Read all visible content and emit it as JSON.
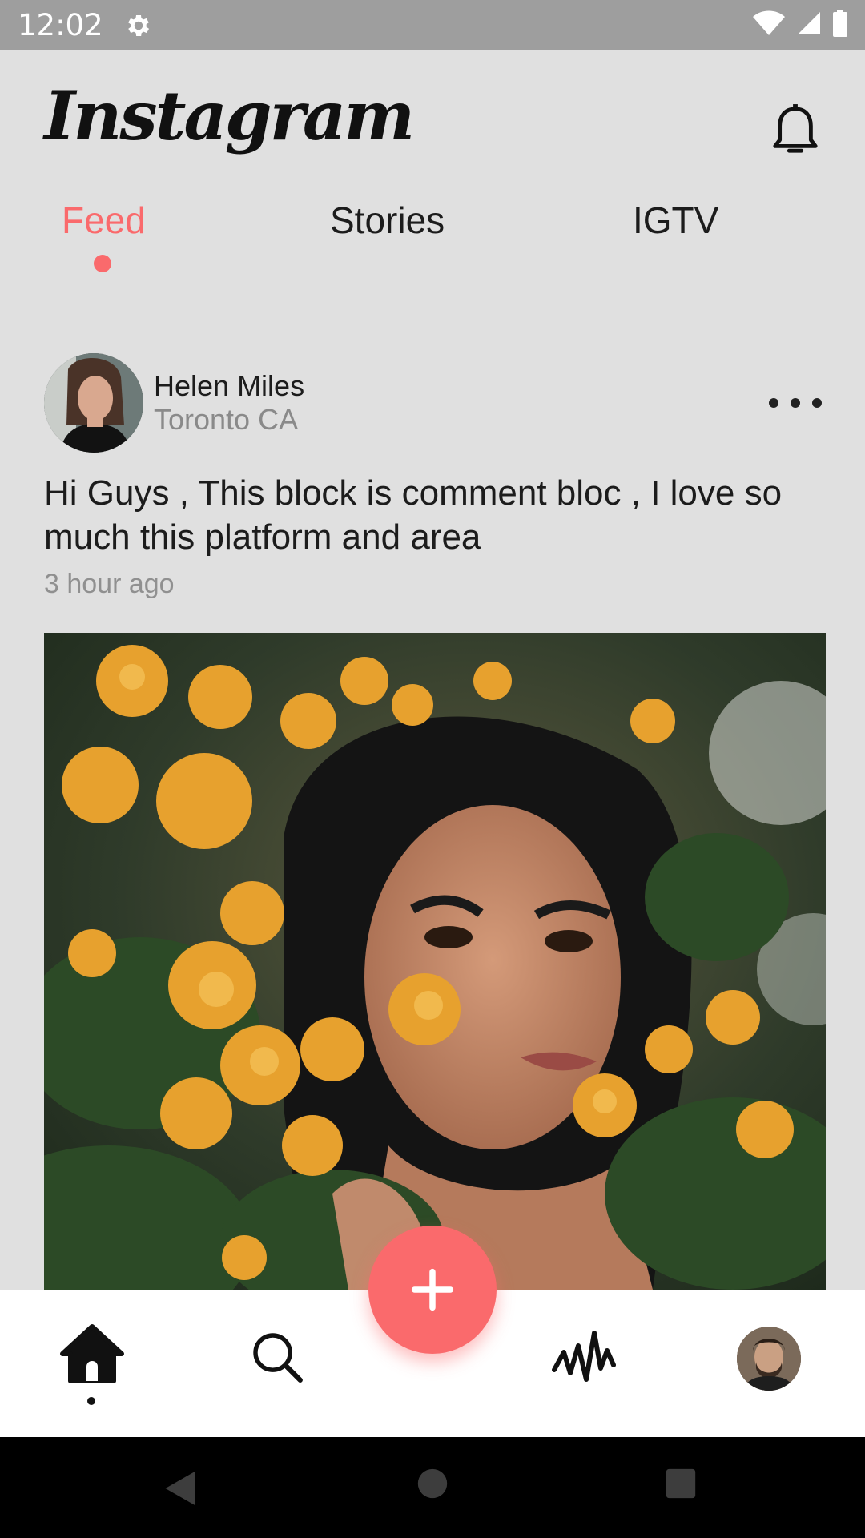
{
  "status_bar": {
    "time": "12:02",
    "icons": [
      "settings-icon",
      "wifi-icon",
      "signal-icon",
      "battery-icon"
    ]
  },
  "header": {
    "logo_text": "Instagram",
    "bell_icon": "bell-icon"
  },
  "tabs": [
    {
      "label": "Feed",
      "active": true
    },
    {
      "label": "Stories",
      "active": false
    },
    {
      "label": "IGTV",
      "active": false
    }
  ],
  "post": {
    "author_name": "Helen Miles",
    "author_location": "Toronto CA",
    "caption": "Hi Guys , This block is comment bloc , I love so much this platform and area",
    "timestamp": "3 hour ago",
    "more_icon": "more-horizontal-icon"
  },
  "bottom_nav": {
    "items": [
      "home-icon",
      "search-icon",
      "add-icon",
      "activity-icon",
      "profile-avatar"
    ],
    "active": "home-icon"
  },
  "system_nav": [
    "back-icon",
    "home-circle-icon",
    "recent-apps-icon"
  ],
  "colors": {
    "accent": "#fa6a6c",
    "background": "#e0e0e0",
    "status_bar": "#9e9e9e",
    "nav_background": "#ffffff"
  }
}
